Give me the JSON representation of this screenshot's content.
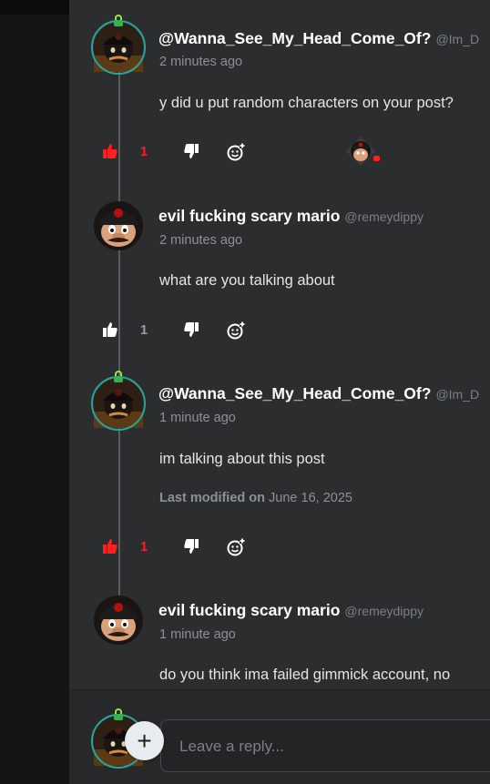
{
  "comments": [
    {
      "name": "@Wanna_See_My_Head_Come_Of?",
      "handle": "@Im_D",
      "time": "2 minutes ago",
      "text": "y did u put random characters on your post?",
      "likes": "1",
      "liked": true,
      "avatar": "dark-mario-avatar-with-ring"
    },
    {
      "name": "evil fucking scary mario",
      "handle": "@remeydippy",
      "time": "2 minutes ago",
      "text": "what are you talking about",
      "likes": "1",
      "liked": false,
      "avatar": "mario-avatar"
    },
    {
      "name": "@Wanna_See_My_Head_Come_Of?",
      "handle": "@Im_D",
      "time": "1 minute ago",
      "text": "im talking about this post",
      "modified_label": "Last modified on",
      "modified_date": "June 16, 2025",
      "likes": "1",
      "liked": true,
      "avatar": "dark-mario-avatar-with-ring"
    },
    {
      "name": "evil fucking scary mario",
      "handle": "@remeydippy",
      "time": "1 minute ago",
      "text": "do you think ima failed gimmick account, no",
      "avatar": "mario-avatar"
    }
  ],
  "reply": {
    "placeholder": "Leave a reply...",
    "add_symbol": "+"
  },
  "colors": {
    "liked": "#ff1f1f",
    "ring": "#2ba39a",
    "panel": "#2b2d2e"
  }
}
